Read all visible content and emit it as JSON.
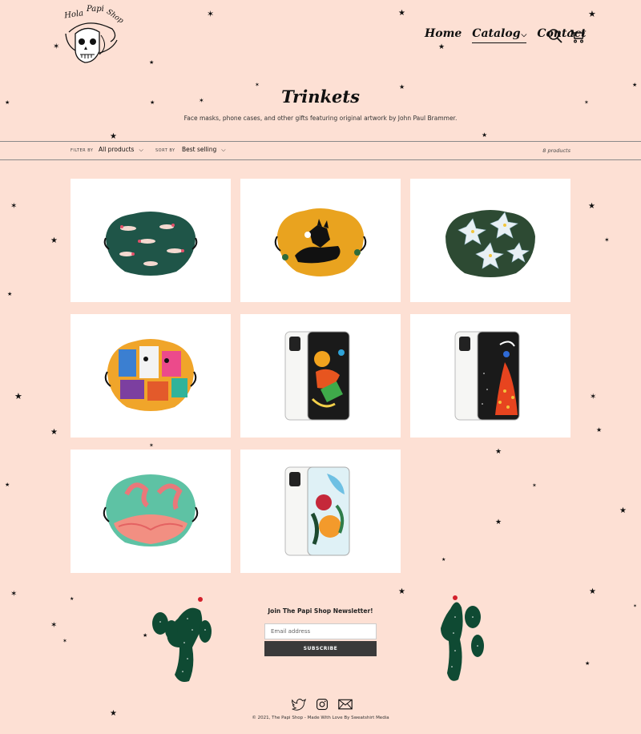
{
  "header": {
    "logo_alt": "Hola Papi Shop",
    "nav": [
      {
        "label": "Home"
      },
      {
        "label": "Catalog"
      },
      {
        "label": "Contact"
      }
    ]
  },
  "collection": {
    "title": "Trinkets",
    "description": "Face masks, phone cases, and other gifts featuring original artwork by John Paul Brammer."
  },
  "filters": {
    "filter_label": "FILTER BY",
    "filter_value": "All products",
    "sort_label": "SORT BY",
    "sort_value": "Best selling",
    "count": "8 products"
  },
  "products": [
    {
      "kind": "mask",
      "art": "axolotl"
    },
    {
      "kind": "mask",
      "art": "dog-yellow"
    },
    {
      "kind": "mask",
      "art": "flowers"
    },
    {
      "kind": "mask",
      "art": "colorful-animals"
    },
    {
      "kind": "phone",
      "art": "hummingbird"
    },
    {
      "kind": "phone",
      "art": "peacock"
    },
    {
      "kind": "mask",
      "art": "flamingo"
    },
    {
      "kind": "phone",
      "art": "pomegranate"
    }
  ],
  "newsletter": {
    "title": "Join The Papi Shop Newsletter!",
    "placeholder": "Email address",
    "button": "SUBSCRIBE"
  },
  "footer": {
    "copyright": "© 2021, The Papi Shop - Made With Love By Sweatshirt Media"
  },
  "colors": {
    "background": "#fde0d4",
    "button": "#3a3a3a",
    "cactus": "#0f4a33"
  }
}
